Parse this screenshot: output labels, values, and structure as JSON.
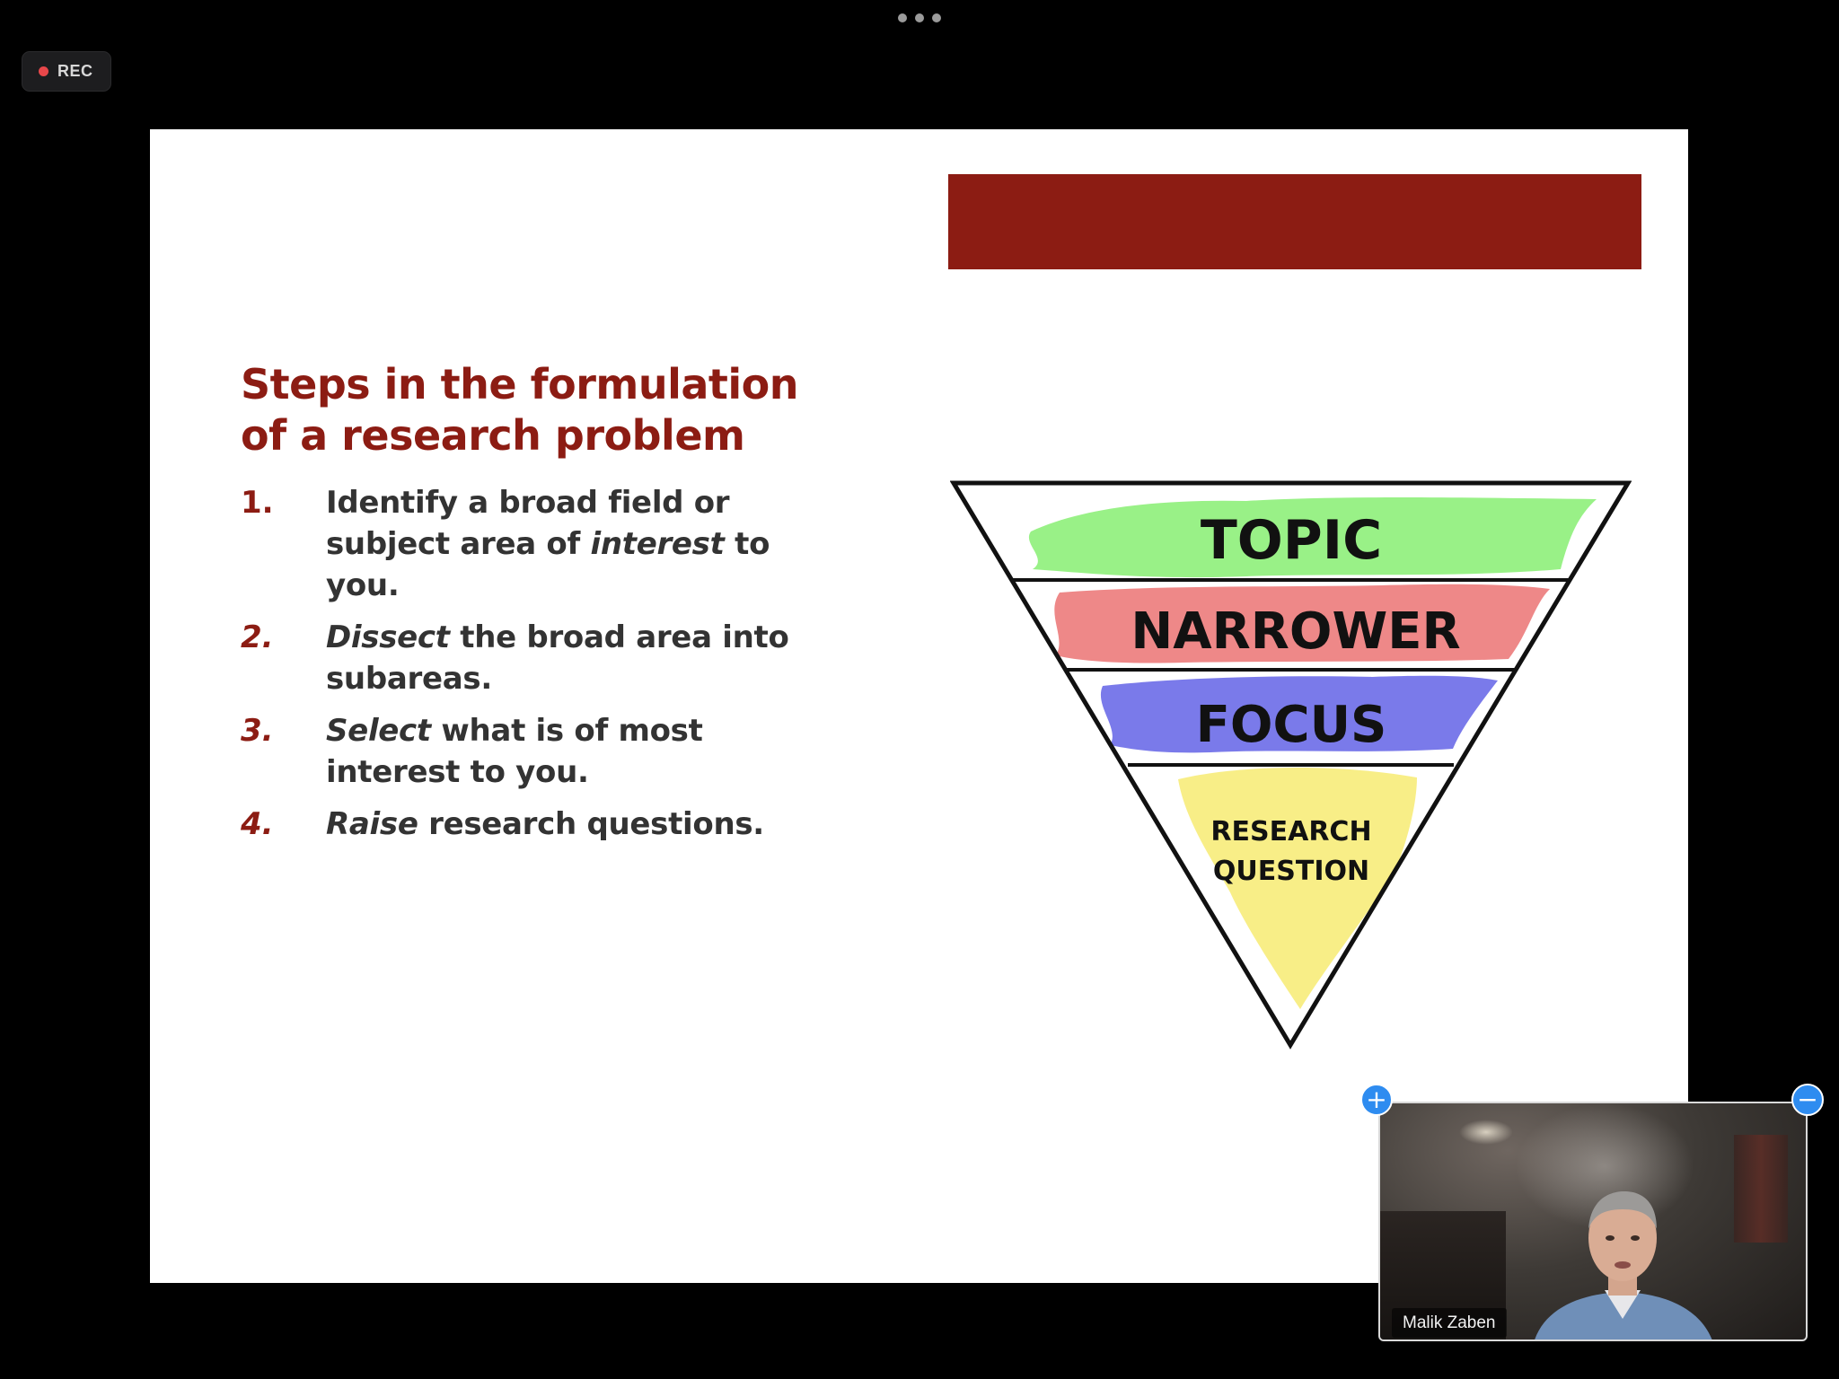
{
  "meeting": {
    "recording_label": "REC",
    "more_menu_icon": "ellipsis-icon"
  },
  "slide": {
    "title_line1": "Steps in the formulation",
    "title_line2": "of a research problem",
    "steps": [
      {
        "num": "1.",
        "italic": "",
        "text": "Identify a broad field or subject area of ",
        "italic_mid": "interest",
        "text_end": " to you."
      },
      {
        "num": "2.",
        "italic": "Dissect",
        "text": " the broad area into subareas.",
        "italic_mid": "",
        "text_end": ""
      },
      {
        "num": "3.",
        "italic": "Select",
        "text": " what is of most interest to you.",
        "italic_mid": "",
        "text_end": ""
      },
      {
        "num": "4.",
        "italic": "Raise",
        "text": " research questions.",
        "italic_mid": "",
        "text_end": ""
      }
    ],
    "funnel": {
      "levels": [
        "TOPIC",
        "NARROWER",
        "FOCUS"
      ],
      "bottom_line1": "RESEARCH",
      "bottom_line2": "QUESTION"
    }
  },
  "video": {
    "participant_name": "Malik Zaben",
    "expand_label": "+",
    "minimize_label": "−"
  },
  "colors": {
    "accent_red": "#8c1c13",
    "topic_green": "#8ef07a",
    "narrower_red": "#ec7b7b",
    "focus_blue": "#6b6be8",
    "question_yellow": "#f7ec7a",
    "pip_button_blue": "#2e8cf0"
  }
}
